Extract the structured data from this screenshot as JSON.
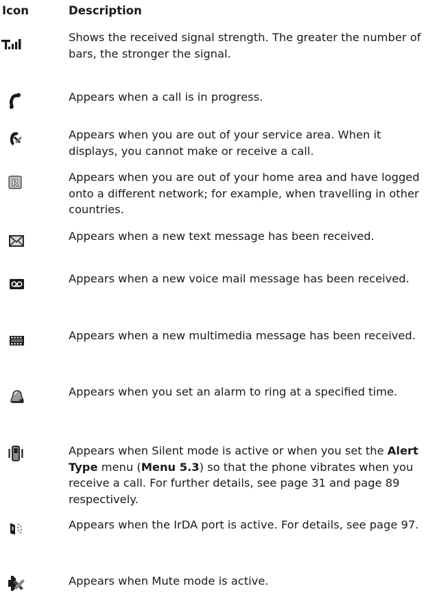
{
  "header": {
    "icon_label": "Icon",
    "description_label": "Description"
  },
  "rows": [
    {
      "icon": "signal-strength-icon",
      "parts": [
        "Shows the received signal strength. The greater the number of bars, the stronger the signal."
      ]
    },
    {
      "icon": "call-in-progress-icon",
      "parts": [
        "Appears when a call is in progress."
      ]
    },
    {
      "icon": "no-service-icon",
      "parts": [
        "Appears when you are out of your service area. When it displays, you cannot make or receive a call."
      ]
    },
    {
      "icon": "roaming-icon",
      "parts": [
        "Appears when you are out of your home area and have logged onto a different network; for example, when travelling in other countries."
      ]
    },
    {
      "icon": "text-message-icon",
      "parts": [
        "Appears when a new text message has been received."
      ]
    },
    {
      "icon": "voice-mail-icon",
      "parts": [
        "Appears when a new voice mail message has been received."
      ]
    },
    {
      "icon": "multimedia-message-icon",
      "parts": [
        "Appears when a new multimedia message has been received."
      ]
    },
    {
      "icon": "alarm-icon",
      "parts": [
        "Appears when you set an alarm to ring at a specified time."
      ]
    },
    {
      "icon": "vibration-icon",
      "parts": [
        "Appears when Silent mode is active or when you set the ",
        "Alert Type",
        " menu (",
        "Menu 5.3",
        ") so that the phone vibrates when you receive a call. For further details, see page 31 and page 89 respectively."
      ]
    },
    {
      "icon": "irda-icon",
      "parts": [
        "Appears when the IrDA port is active. For details, see page 97."
      ]
    },
    {
      "icon": "mute-icon",
      "parts": [
        "Appears when Mute mode is active."
      ]
    }
  ]
}
